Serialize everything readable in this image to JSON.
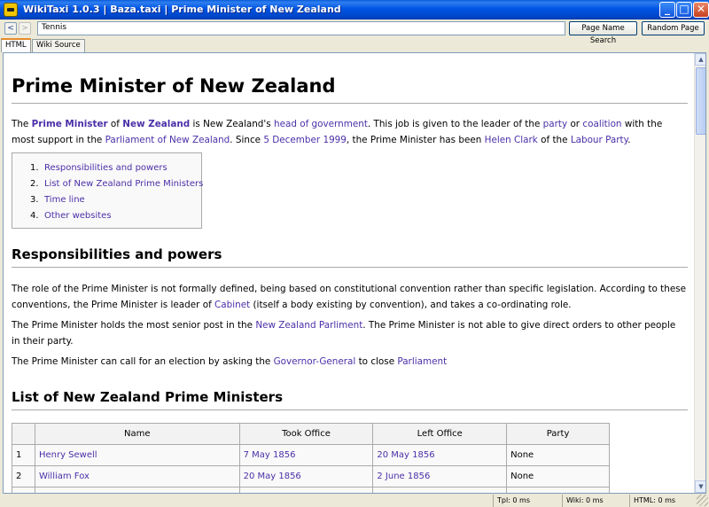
{
  "window": {
    "title": "WikiTaxi 1.0.3  |  Baza.taxi  |  Prime Minister of New Zealand",
    "min_glyph": "_",
    "max_glyph": "□",
    "close_glyph": "✕"
  },
  "toolbar": {
    "back_glyph": "<",
    "forward_glyph": ">",
    "search_value": "Tennis",
    "page_name_search_label": "Page Name Search",
    "random_page_label": "Random Page"
  },
  "tabs": [
    {
      "label": "HTML",
      "active": true
    },
    {
      "label": "Wiki Source",
      "active": false
    }
  ],
  "article": {
    "title": "Prime Minister of New Zealand",
    "intro": {
      "t1": "The ",
      "l1": "Prime Minister",
      "t2": " of ",
      "l2": "New Zealand",
      "t3": " is New Zealand's ",
      "l3": "head of government",
      "t4": ". This job is given to the leader of the ",
      "l4": "party",
      "t5": " or ",
      "l5": "coalition",
      "t6": " with the most support in the ",
      "l6": "Parliament of New Zealand",
      "t7": ". Since ",
      "l7": "5 December 1999",
      "t8": ", the Prime Minister has been ",
      "l8": "Helen Clark",
      "t9": " of the ",
      "l9": "Labour Party",
      "t10": "."
    },
    "toc": [
      {
        "num": "1.",
        "label": "Responsibilities and powers"
      },
      {
        "num": "2.",
        "label": "List of New Zealand Prime Ministers"
      },
      {
        "num": "3.",
        "label": "Time line"
      },
      {
        "num": "4.",
        "label": "Other websites"
      }
    ],
    "section1": {
      "heading": "Responsibilities and powers",
      "p1": {
        "t1": "The role of the Prime Minister is not formally defined, being based on constitutional convention rather than specific legislation. According to these conventions, the Prime Minister is leader of ",
        "l1": "Cabinet",
        "t2": " (itself a body existing by convention), and takes a co-ordinating role."
      },
      "p2": {
        "t1": "The Prime Minister holds the most senior post in the ",
        "l1": "New Zealand Parliment",
        "t2": ". The Prime Minister is not able to give direct orders to other people in their party."
      },
      "p3": {
        "t1": "The Prime Minister can call for an election by asking the ",
        "l1": "Governor-General",
        "t2": " to close ",
        "l2": "Parliament"
      }
    },
    "section2": {
      "heading": "List of New Zealand Prime Ministers",
      "columns": [
        "",
        "Name",
        "Took Office",
        "Left Office",
        "Party"
      ],
      "rows": [
        {
          "n": "1",
          "name": "Henry Sewell",
          "took": "7 May 1856",
          "left": "20 May 1856",
          "party": "None"
        },
        {
          "n": "2",
          "name": "William Fox",
          "took": "20 May 1856",
          "left": "2 June 1856",
          "party": "None"
        }
      ]
    }
  },
  "status": {
    "tpl": "Tpl: 0 ms",
    "wiki": "Wiki: 0 ms",
    "html": "HTML: 0 ms"
  }
}
